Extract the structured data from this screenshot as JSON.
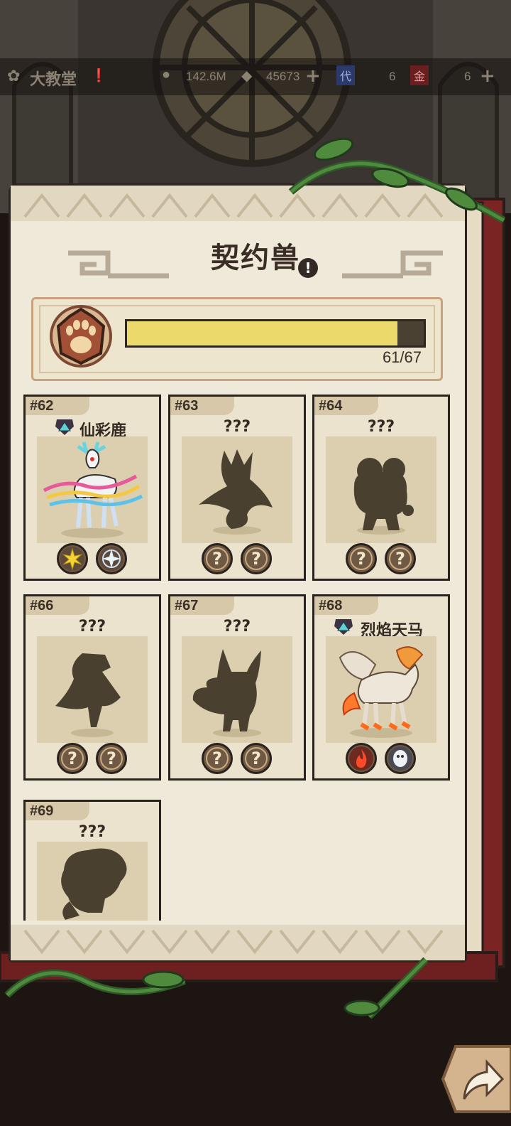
{
  "header": {
    "location": "大教堂",
    "gold": "142.6M",
    "crystal": "45673",
    "item1_badge": "代",
    "item1_count": "6",
    "item2_badge": "金",
    "item2_count": "6"
  },
  "page": {
    "title": "契约兽",
    "info_icon": "!"
  },
  "progress": {
    "text": "61/67",
    "value": 61,
    "max": 67
  },
  "beasts": [
    {
      "num": "#62",
      "name": "仙彩鹿",
      "known": true,
      "skills": [
        "sun-icon",
        "star-compass-icon"
      ]
    },
    {
      "num": "#63",
      "name": "???",
      "known": false,
      "skills": [
        "?",
        "?"
      ]
    },
    {
      "num": "#64",
      "name": "???",
      "known": false,
      "skills": [
        "?",
        "?"
      ]
    },
    {
      "num": "#66",
      "name": "???",
      "known": false,
      "skills": [
        "?",
        "?"
      ]
    },
    {
      "num": "#67",
      "name": "???",
      "known": false,
      "skills": [
        "?",
        "?"
      ]
    },
    {
      "num": "#68",
      "name": "烈焰天马",
      "known": true,
      "skills": [
        "fire-icon",
        "spirit-icon"
      ]
    },
    {
      "num": "#69",
      "name": "???",
      "known": false,
      "skills": []
    }
  ],
  "colors": {
    "page": "#efe9d9",
    "bar_fill": "#ecd96b",
    "frame": "#c9a27d"
  }
}
